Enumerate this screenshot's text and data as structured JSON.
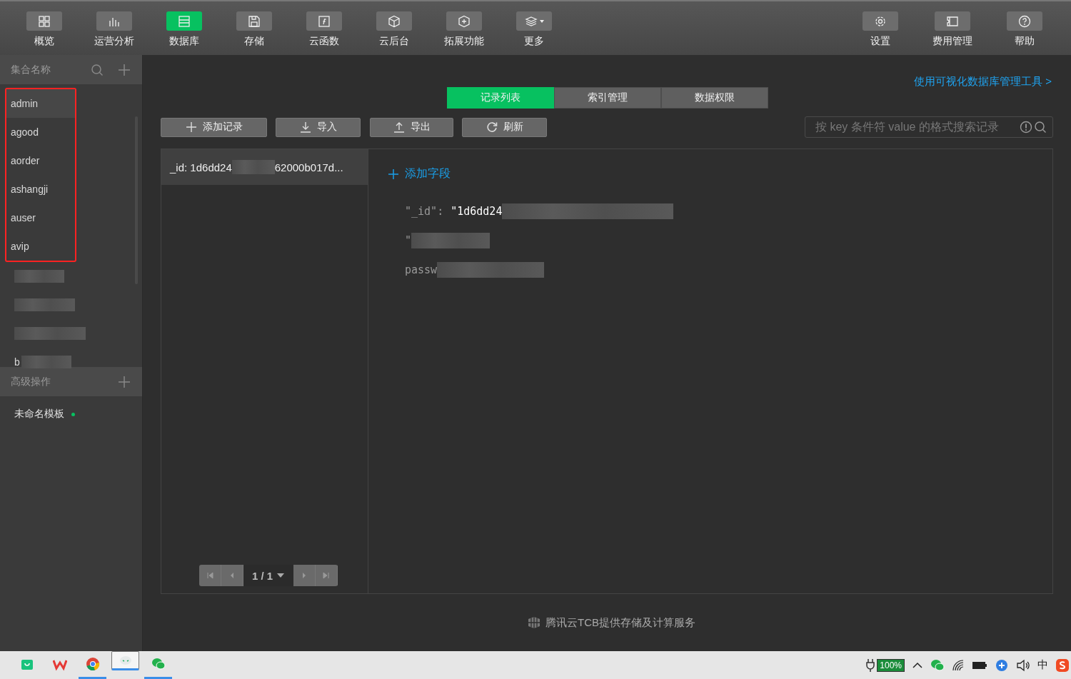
{
  "top_nav": {
    "items": [
      {
        "label": "概览",
        "selected": false
      },
      {
        "label": "运营分析",
        "selected": false
      },
      {
        "label": "数据库",
        "selected": true
      },
      {
        "label": "存储",
        "selected": false
      },
      {
        "label": "云函数",
        "selected": false
      },
      {
        "label": "云后台",
        "selected": false
      },
      {
        "label": "拓展功能",
        "selected": false
      },
      {
        "label": "更多",
        "selected": false
      }
    ],
    "right_items": [
      {
        "label": "设置",
        "selected": false
      },
      {
        "label": "费用管理",
        "selected": false
      },
      {
        "label": "帮助",
        "selected": false
      }
    ]
  },
  "sidebar": {
    "collections_header": "集合名称",
    "collections": [
      {
        "kind": "name",
        "label": "admin",
        "selected": true,
        "highlighted": true
      },
      {
        "kind": "name",
        "label": "agood",
        "selected": false,
        "highlighted": true
      },
      {
        "kind": "name",
        "label": "aorder",
        "selected": false,
        "highlighted": true
      },
      {
        "kind": "name",
        "label": "ashangji",
        "selected": false,
        "highlighted": true
      },
      {
        "kind": "name",
        "label": "auser",
        "selected": false,
        "highlighted": true
      },
      {
        "kind": "name",
        "label": "avip",
        "selected": false,
        "highlighted": true
      },
      {
        "kind": "redacted",
        "selected": false,
        "highlighted": false
      },
      {
        "kind": "redacted",
        "selected": false,
        "highlighted": false
      },
      {
        "kind": "redacted",
        "selected": false,
        "highlighted": false
      },
      {
        "kind": "redacted",
        "label": "b",
        "selected": false,
        "highlighted": false
      }
    ],
    "advanced_header": "高级操作",
    "templates": [
      {
        "label": "未命名模板",
        "modified": true
      }
    ]
  },
  "main": {
    "tabs": [
      {
        "label": "记录列表",
        "selected": true
      },
      {
        "label": "索引管理",
        "selected": false
      },
      {
        "label": "数据权限",
        "selected": false
      }
    ],
    "tool_link": "使用可视化数据库管理工具 >",
    "actions": [
      {
        "label": "添加记录"
      },
      {
        "label": "导入"
      },
      {
        "label": "导出"
      },
      {
        "label": "刷新"
      }
    ],
    "search": {
      "placeholder": "按 key 条件符 value 的格式搜索记录"
    },
    "records": [
      {
        "prefix": "_id: 1d6dd24",
        "suffix": "62000b017d...",
        "selected": true
      }
    ],
    "pager": {
      "page": "1 / 1"
    },
    "add_field": "添加字段",
    "fields": [
      {
        "key": "\"_id\":",
        "value": "\"1d6dd24"
      },
      {
        "key": "\""
      },
      {
        "key": "passw"
      }
    ],
    "footer": "腾讯云TCB提供存储及计算服务"
  },
  "taskbar": {
    "apps": [
      {
        "running": false,
        "active": false
      },
      {
        "running": false,
        "active": false
      },
      {
        "running": true,
        "active": false
      },
      {
        "running": true,
        "active": true
      },
      {
        "running": true,
        "active": false
      }
    ],
    "battery_label": "100%",
    "ime": "中"
  }
}
